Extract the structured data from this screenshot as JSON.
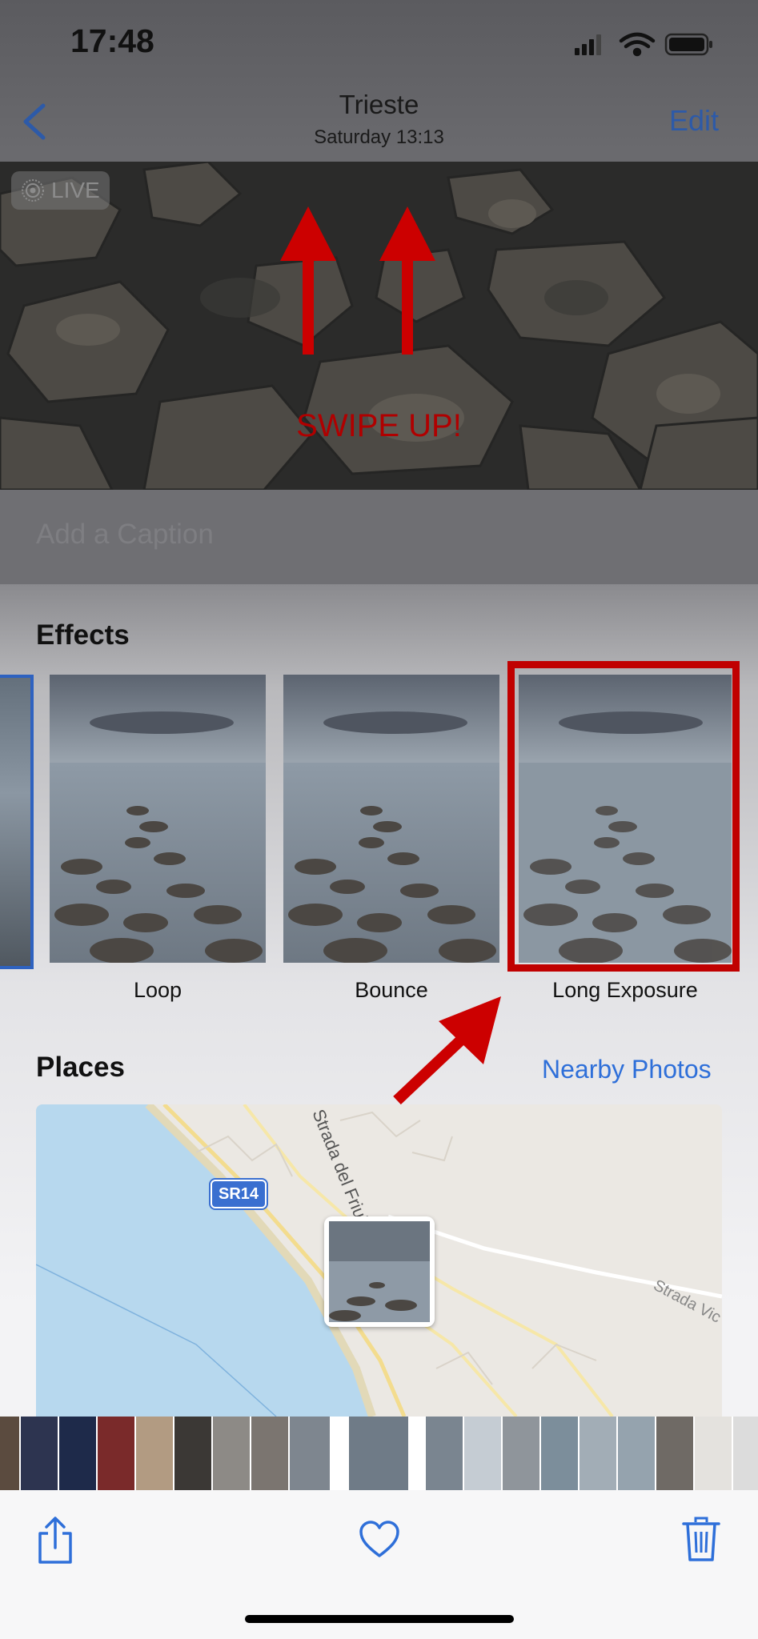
{
  "status_bar": {
    "time": "17:48",
    "icons": [
      "cellular-signal-icon",
      "wifi-icon",
      "battery-icon"
    ]
  },
  "nav": {
    "back_icon": "chevron-left-icon",
    "title": "Trieste",
    "subtitle": "Saturday  13:13",
    "edit_label": "Edit"
  },
  "hero": {
    "live_label": "LIVE",
    "live_icon": "live-photo-icon",
    "overlay_text": "SWIPE UP!",
    "arrow_color": "#cc0000"
  },
  "caption": {
    "placeholder": "Add a Caption"
  },
  "effects": {
    "title": "Effects",
    "items": [
      {
        "label": "Loop"
      },
      {
        "label": "Bounce"
      },
      {
        "label": "Long Exposure"
      }
    ],
    "highlight_color": "#c00000"
  },
  "places": {
    "title": "Places",
    "nearby_label": "Nearby Photos",
    "map": {
      "route_badge": "SR14",
      "road_label_1": "Strada del Friuli",
      "road_label_2": "Strada Vic"
    }
  },
  "toolbar": {
    "icons": [
      "share-icon",
      "heart-icon",
      "trash-icon"
    ]
  },
  "colors": {
    "accent": "#2e6fd9",
    "annotation_red": "#cc0000"
  }
}
